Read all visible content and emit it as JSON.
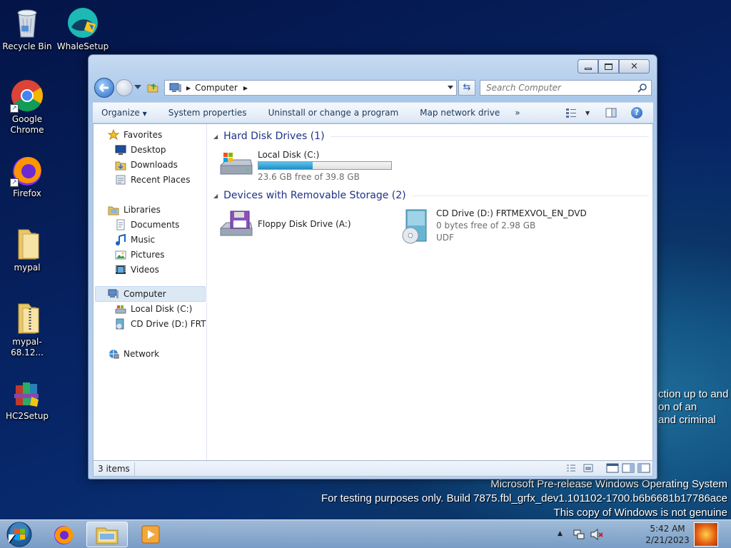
{
  "desktop": {
    "icons": [
      {
        "label": "Recycle Bin",
        "icon": "recycle-bin-icon"
      },
      {
        "label": "WhaleSetup",
        "icon": "whale-setup-icon"
      },
      {
        "label": "Google Chrome",
        "icon": "chrome-icon"
      },
      {
        "label": "Firefox",
        "icon": "firefox-icon"
      },
      {
        "label": "mypal",
        "icon": "folder-icon"
      },
      {
        "label": "mypal-68.12...",
        "icon": "zip-folder-icon"
      },
      {
        "label": "HC2Setup",
        "icon": "installer-icon"
      }
    ],
    "bg_text": [
      "ction up to and",
      "on of an",
      "and criminal"
    ],
    "watermark": [
      "Microsoft Pre-release Windows Operating System",
      "For testing purposes only. Build 7875.fbl_grfx_dev1.101102-1700.b6b6681b17786ace",
      "This copy of Windows is not genuine"
    ]
  },
  "window": {
    "address": {
      "crumb": "Computer"
    },
    "search": {
      "placeholder": "Search Computer"
    },
    "toolbar": {
      "organize": "Organize",
      "system_properties": "System properties",
      "uninstall": "Uninstall or change a program",
      "map_network": "Map network drive",
      "more": "»"
    },
    "nav": {
      "favorites": "Favorites",
      "desktop": "Desktop",
      "downloads": "Downloads",
      "recent": "Recent Places",
      "libraries": "Libraries",
      "documents": "Documents",
      "music": "Music",
      "pictures": "Pictures",
      "videos": "Videos",
      "computer": "Computer",
      "local_disk": "Local Disk (C:)",
      "cd_drive": "CD Drive (D:) FRTMEXVOL_EN_DVD",
      "network": "Network"
    },
    "groups": {
      "hdd": "Hard Disk Drives (1)",
      "removable": "Devices with Removable Storage (2)"
    },
    "drives": {
      "c": {
        "name": "Local Disk (C:)",
        "free": "23.6 GB free of 39.8 GB",
        "used_fraction": 0.407
      },
      "a": {
        "name": "Floppy Disk Drive (A:)"
      },
      "d": {
        "name": "CD Drive (D:) FRTMEXVOL_EN_DVD",
        "free": "0 bytes free of 2.98 GB",
        "fs": "UDF"
      }
    },
    "status": {
      "count": "3 items"
    }
  },
  "taskbar": {
    "time": "5:42 AM",
    "date": "2/21/2023",
    "apps": [
      "start-orb-icon",
      "firefox-icon",
      "explorer-icon",
      "media-player-icon"
    ]
  },
  "colors": {
    "accent": "#1e3287",
    "progress": "#26a0da"
  }
}
